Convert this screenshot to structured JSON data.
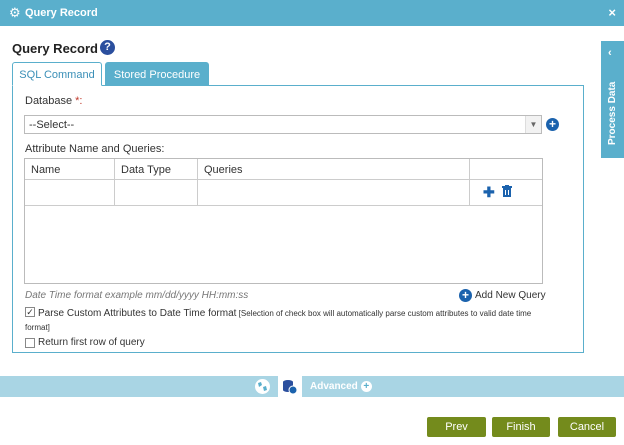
{
  "window": {
    "title": "Query Record",
    "close_glyph": "×",
    "icon": "gear-icon"
  },
  "heading": {
    "title": "Query Record",
    "help_glyph": "?"
  },
  "tabs": [
    {
      "label": "SQL Command",
      "active": true
    },
    {
      "label": "Stored Procedure",
      "active": false
    }
  ],
  "database": {
    "label": "Database ",
    "required_mark": "*:",
    "selected": "--Select--"
  },
  "attributes": {
    "label": "Attribute Name and Queries:",
    "columns": [
      "Name",
      "Data Type",
      "Queries",
      ""
    ]
  },
  "datetime_hint": "Date Time format example mm/dd/yyyy HH:mm:ss",
  "add_new_query": "Add New Query",
  "parse_option": {
    "checked": true,
    "label": "Parse Custom Attributes to Date Time format",
    "note": "[Selection of check box will automatically parse custom attributes to valid date time format]"
  },
  "first_row_option": {
    "checked": false,
    "label": "Return first row of query"
  },
  "bottom_bar": {
    "advanced_label": "Advanced"
  },
  "buttons": {
    "prev": "Prev",
    "finish": "Finish",
    "cancel": "Cancel"
  },
  "side_panel": {
    "label": "Process Data",
    "chevron": "‹"
  },
  "colors": {
    "header": "#5aafcc",
    "button": "#748b1c",
    "accent": "#1b62ad",
    "required": "#c0392b"
  }
}
